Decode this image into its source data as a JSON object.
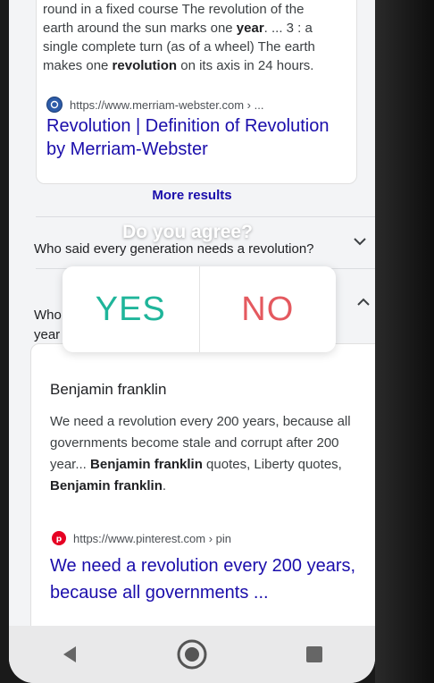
{
  "result1": {
    "snippet_line1": "round in a fixed course The revolution of the",
    "snippet_line2_a": "earth around the sun marks one ",
    "snippet_line2_b": "year",
    "snippet_line2_c": ". ... 3 : a",
    "snippet_line3": "single complete turn (as of a wheel) The earth",
    "snippet_line4_a": "makes one ",
    "snippet_line4_b": "revolution",
    "snippet_line4_c": " on its axis in 24 hours.",
    "source_url": "https://www.merriam-webster.com › ...",
    "title_line1": "Revolution | Definition of Revolution",
    "title_line2": "by Merriam-Webster"
  },
  "more_results": "More results",
  "faq": [
    {
      "question": "Who said every generation needs a revolution?"
    },
    {
      "question_part1": "Who",
      "question_part2": "year"
    }
  ],
  "poll": {
    "question": "Do you agree?",
    "yes": "YES",
    "no": "NO",
    "yes_color": "#1fb59a",
    "no_color": "#e4595f"
  },
  "answer": {
    "heading": "Benjamin franklin",
    "text_1": "We need a revolution every 200 years, because all governments become stale and corrupt after 200 year... ",
    "text_b1": "Benjamin franklin",
    "text_2": " quotes, Liberty quotes, ",
    "text_b2": "Benjamin franklin",
    "text_3": ".",
    "source_url": "https://www.pinterest.com › pin",
    "title": "We need a revolution every 200 years, because all governments ..."
  },
  "icons": {
    "merriam": "merriam-webster-favicon",
    "pinterest": "pinterest-favicon",
    "expand": "chevron-down-icon",
    "collapse": "chevron-up-icon",
    "back": "back-triangle-icon",
    "home": "home-circle-icon",
    "recents": "recents-square-icon"
  }
}
